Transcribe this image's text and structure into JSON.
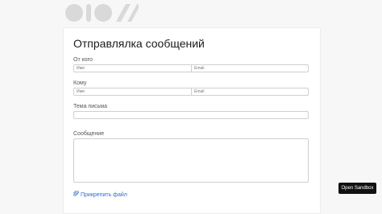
{
  "form": {
    "title": "Отправлялка сообщений",
    "from_label": "От кого",
    "from_name_placeholder": "Имя",
    "from_email_placeholder": "Email",
    "to_label": "Кому",
    "to_name_placeholder": "Имя",
    "to_email_placeholder": "Email",
    "subject_label": "Тема письма",
    "message_label": "Сообщение",
    "attach_label": "Прикрепить файл"
  },
  "sandbox": {
    "label": "Open Sandbox"
  },
  "icons": {
    "logo": "brand-logo-icon",
    "attach": "paperclip-icon"
  },
  "colors": {
    "link": "#2f6fd6",
    "sandbox_bg": "#111111",
    "logo": "#d9d9d9"
  }
}
